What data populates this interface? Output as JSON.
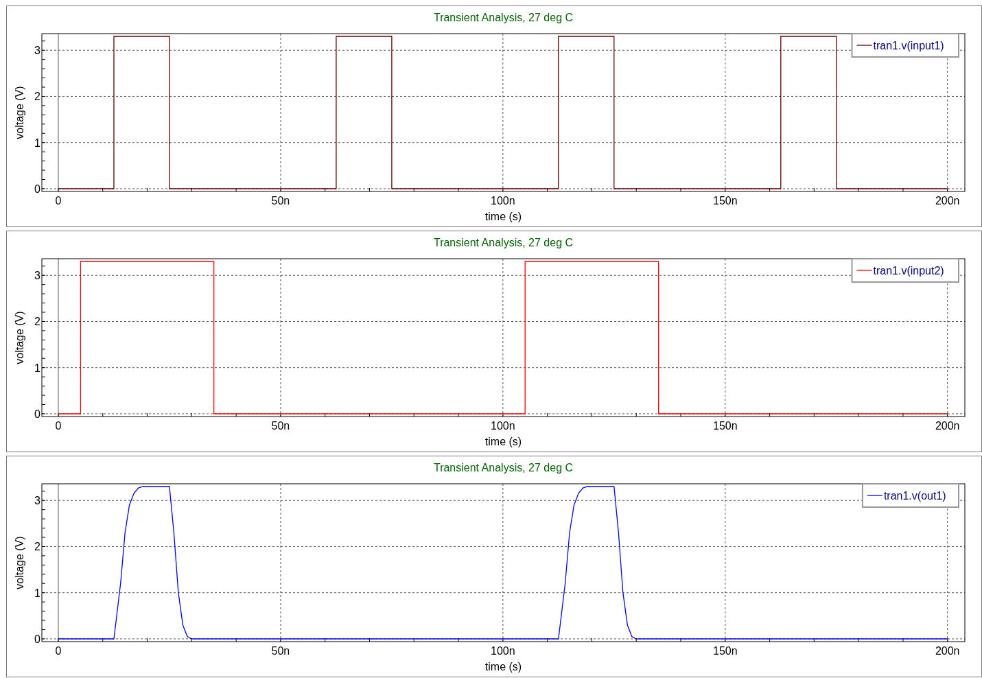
{
  "panels": [
    {
      "chart_data": {
        "type": "line",
        "title": "Transient Analysis, 27 deg C",
        "xlabel": "time (s)",
        "ylabel": "voltage (V)",
        "xlim": [
          -3.7,
          203.9
        ],
        "ylim": [
          -0.06,
          3.36
        ],
        "xticks": [
          {
            "value": 0,
            "label": "0"
          },
          {
            "value": 50,
            "label": "50n"
          },
          {
            "value": 100,
            "label": "100n"
          },
          {
            "value": 150,
            "label": "150n"
          },
          {
            "value": 200,
            "label": "200n"
          }
        ],
        "yticks": [
          0,
          1,
          2,
          3
        ],
        "x": [
          0,
          12.5,
          12.5,
          25,
          25,
          62.5,
          62.5,
          75,
          75,
          112.5,
          112.5,
          125,
          125,
          162.5,
          162.5,
          175,
          175,
          200
        ],
        "grid": true,
        "series": [
          {
            "name": "tran1.v(input1)",
            "color": "#660000",
            "values": [
              0,
              0,
              3.3,
              3.3,
              0,
              0,
              3.3,
              3.3,
              0,
              0,
              3.3,
              3.3,
              0,
              0,
              3.3,
              3.3,
              0,
              0
            ]
          }
        ]
      }
    },
    {
      "chart_data": {
        "type": "line",
        "title": "Transient Analysis, 27 deg C",
        "xlabel": "time (s)",
        "ylabel": "voltage (V)",
        "xlim": [
          -3.7,
          203.9
        ],
        "ylim": [
          -0.06,
          3.36
        ],
        "xticks": [
          {
            "value": 0,
            "label": "0"
          },
          {
            "value": 50,
            "label": "50n"
          },
          {
            "value": 100,
            "label": "100n"
          },
          {
            "value": 150,
            "label": "150n"
          },
          {
            "value": 200,
            "label": "200n"
          }
        ],
        "yticks": [
          0,
          1,
          2,
          3
        ],
        "x": [
          0,
          5,
          5,
          35,
          35,
          105,
          105,
          135,
          135,
          200
        ],
        "grid": true,
        "series": [
          {
            "name": "tran1.v(input2)",
            "color": "#ff0000",
            "values": [
              0,
              0,
              3.3,
              3.3,
              0,
              0,
              3.3,
              3.3,
              0,
              0
            ]
          }
        ]
      }
    },
    {
      "chart_data": {
        "type": "line",
        "title": "Transient Analysis, 27 deg C",
        "xlabel": "time (s)",
        "ylabel": "voltage (V)",
        "xlim": [
          -3.7,
          203.9
        ],
        "ylim": [
          -0.06,
          3.36
        ],
        "xticks": [
          {
            "value": 0,
            "label": "0"
          },
          {
            "value": 50,
            "label": "50n"
          },
          {
            "value": 100,
            "label": "100n"
          },
          {
            "value": 150,
            "label": "150n"
          },
          {
            "value": 200,
            "label": "200n"
          }
        ],
        "yticks": [
          0,
          1,
          2,
          3
        ],
        "x": [
          0,
          12.5,
          14,
          15,
          16,
          17,
          18,
          19,
          25,
          26,
          27,
          28,
          29,
          30,
          112.5,
          114,
          115,
          116,
          117,
          118,
          119,
          125,
          126,
          127,
          128,
          129,
          130,
          200
        ],
        "grid": true,
        "series": [
          {
            "name": "tran1.v(out1)",
            "color": "#0000ff",
            "values": [
              0,
              0,
              1.2,
              2.3,
              2.9,
              3.15,
              3.27,
              3.3,
              3.3,
              2.3,
              1.0,
              0.3,
              0.05,
              0,
              0,
              1.2,
              2.3,
              2.9,
              3.15,
              3.27,
              3.3,
              3.3,
              2.3,
              1.0,
              0.3,
              0.05,
              0,
              0
            ]
          }
        ]
      }
    }
  ]
}
